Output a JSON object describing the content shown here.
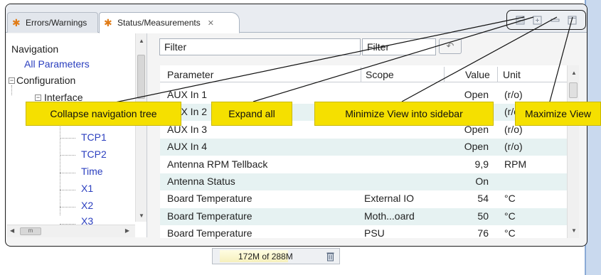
{
  "tabs": [
    {
      "label": "Errors/Warnings",
      "icon": "gear-icon",
      "active": false
    },
    {
      "label": "Status/Measurements",
      "icon": "gear-icon",
      "active": true,
      "close": "✕"
    }
  ],
  "view_toolbar": {
    "icons": [
      "collapse-all-icon",
      "expand-all-icon",
      "minimize-icon",
      "maximize-icon"
    ]
  },
  "navigation": {
    "title": "Navigation",
    "items": [
      {
        "label": "All Parameters",
        "style": "link"
      },
      {
        "label": "Configuration",
        "style": "plain",
        "expander": "⊟"
      },
      {
        "label": "Interface",
        "style": "plain",
        "expander": "⊟"
      },
      {
        "label": "TCP1",
        "style": "link"
      },
      {
        "label": "TCP2",
        "style": "link"
      },
      {
        "label": "Time",
        "style": "link"
      },
      {
        "label": "X1",
        "style": "link"
      },
      {
        "label": "X2",
        "style": "link"
      },
      {
        "label": "X3",
        "style": "link"
      }
    ],
    "hscroll_thumb": "m"
  },
  "filters": {
    "parameter_filter": "Filter",
    "scope_filter": "Filter",
    "reset_icon": "undo-icon"
  },
  "table": {
    "columns": [
      "Parameter",
      "Scope",
      "Value",
      "Unit"
    ],
    "rows": [
      {
        "parameter": "AUX In 1",
        "scope": "",
        "value": "Open",
        "unit": "(r/o)"
      },
      {
        "parameter": "AUX In 2",
        "scope": "",
        "value": "Open",
        "unit": "(r/o)"
      },
      {
        "parameter": "AUX In 3",
        "scope": "",
        "value": "Open",
        "unit": "(r/o)"
      },
      {
        "parameter": "AUX In 4",
        "scope": "",
        "value": "Open",
        "unit": "(r/o)"
      },
      {
        "parameter": "Antenna RPM Tellback",
        "scope": "",
        "value": "9,9",
        "unit": "RPM"
      },
      {
        "parameter": "Antenna Status",
        "scope": "",
        "value": "On",
        "unit": ""
      },
      {
        "parameter": "Board Temperature",
        "scope": "External IO",
        "value": "54",
        "unit": "°C"
      },
      {
        "parameter": "Board Temperature",
        "scope": "Moth...oard",
        "value": "50",
        "unit": "°C"
      },
      {
        "parameter": "Board Temperature",
        "scope": "PSU",
        "value": "76",
        "unit": "°C"
      }
    ]
  },
  "status_bar": {
    "heap": "172M of 288M",
    "heap_used_fraction": 0.597,
    "gc_icon": "trash-icon"
  },
  "callouts": [
    {
      "label": "Collapse navigation tree"
    },
    {
      "label": "Expand all"
    },
    {
      "label": "Minimize View into sidebar"
    },
    {
      "label": "Maximize View"
    }
  ],
  "colors": {
    "callout": "#f5e000",
    "link": "#2b3fbf",
    "row_alt": "#e6f2f2",
    "tab_icon": "#e07b16"
  }
}
